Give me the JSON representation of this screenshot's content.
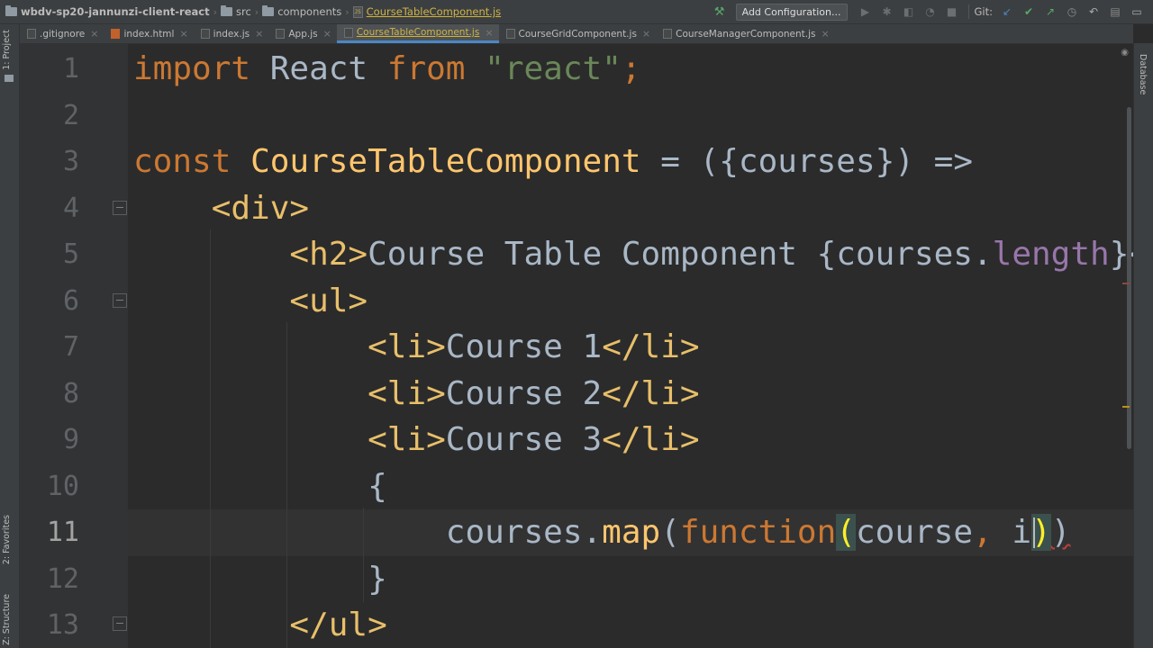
{
  "navbar": {
    "project": "wbdv-sp20-jannunzi-client-react",
    "crumbs": [
      "src",
      "components"
    ],
    "current_file": "CourseTableComponent.js",
    "add_configuration": "Add Configuration...",
    "git_label": "Git:"
  },
  "tabs": [
    {
      "label": ".gitignore",
      "active": false
    },
    {
      "label": "index.html",
      "active": false
    },
    {
      "label": "index.js",
      "active": false
    },
    {
      "label": "App.js",
      "active": false
    },
    {
      "label": "CourseTableComponent.js",
      "active": true
    },
    {
      "label": "CourseGridComponent.js",
      "active": false
    },
    {
      "label": "CourseManagerComponent.js",
      "active": false
    }
  ],
  "left_tools": {
    "project": "1: Project",
    "favorites": "2: Favorites",
    "structure": "Z: Structure"
  },
  "right_tools": {
    "database": "Database"
  },
  "editor": {
    "current_line": 11,
    "line_numbers": [
      "1",
      "2",
      "3",
      "4",
      "5",
      "6",
      "7",
      "8",
      "9",
      "10",
      "11",
      "12",
      "13"
    ],
    "lines": {
      "l1": {
        "import": "import",
        "react_id": " React ",
        "from": "from",
        "space": " ",
        "str": "\"react\"",
        "semi": ";"
      },
      "l3": {
        "const": "const",
        "sp": " ",
        "name": "CourseTableComponent",
        "rest": " = ({courses}) =>"
      },
      "l4": {
        "indent": "    ",
        "tag": "<div>"
      },
      "l5": {
        "indent": "        ",
        "open": "<h2>",
        "text": "Course Table Component {courses.",
        "prop": "length",
        "close": "}</"
      },
      "l6": {
        "indent": "        ",
        "tag": "<ul>"
      },
      "l7": {
        "indent": "            ",
        "open": "<li>",
        "text": "Course 1",
        "close": "</li>"
      },
      "l8": {
        "indent": "            ",
        "open": "<li>",
        "text": "Course 2",
        "close": "</li>"
      },
      "l9": {
        "indent": "            ",
        "open": "<li>",
        "text": "Course 3",
        "close": "</li>"
      },
      "l10": {
        "indent": "            ",
        "text": "{"
      },
      "l11": {
        "indent": "                ",
        "obj": "courses.",
        "map": "map",
        "paren": "(",
        "function": "function",
        "open_paren": "(",
        "args": "course",
        "comma": ",",
        "sp": " ",
        "arg2": "i",
        "close_paren": ")",
        "end": ")"
      },
      "l12": {
        "indent": "            ",
        "text": "}"
      },
      "l13": {
        "indent": "        ",
        "tag": "</ul>"
      }
    }
  },
  "colors": {
    "keyword": "#cc7832",
    "string": "#6a8759",
    "tag": "#e8bf6a",
    "function": "#ffc66d",
    "property": "#9876aa",
    "default": "#a9b7c6",
    "background": "#2b2b2b"
  }
}
